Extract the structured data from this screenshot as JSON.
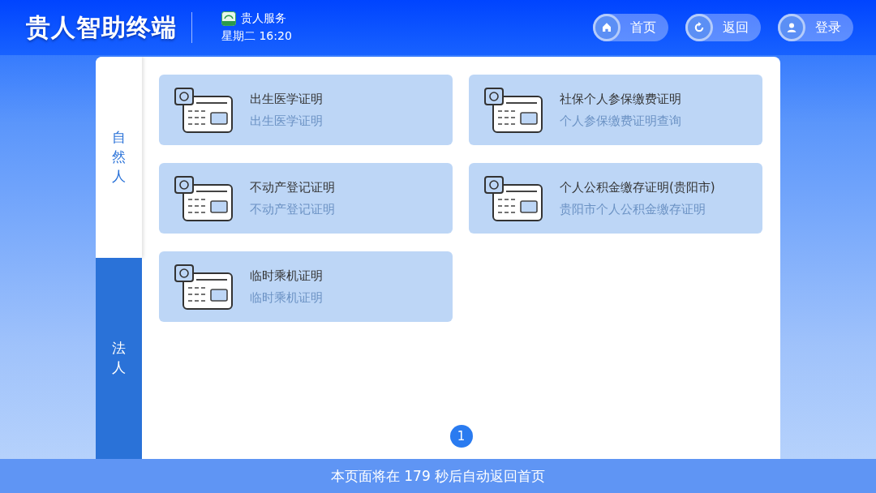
{
  "header": {
    "title": "贵人智助终端",
    "service": "贵人服务",
    "datetime": "星期二 16:20"
  },
  "nav_buttons": [
    {
      "kind": "home",
      "label": "首页"
    },
    {
      "kind": "back",
      "label": "返回"
    },
    {
      "kind": "login",
      "label": "登录"
    }
  ],
  "tabs": [
    {
      "label": "自然人",
      "selected": true
    },
    {
      "label": "法人",
      "selected": false
    }
  ],
  "cards": [
    {
      "title": "出生医学证明",
      "subtitle": "出生医学证明"
    },
    {
      "title": "社保个人参保缴费证明",
      "subtitle": "个人参保缴费证明查询"
    },
    {
      "title": "不动产登记证明",
      "subtitle": "不动产登记证明"
    },
    {
      "title": "个人公积金缴存证明(贵阳市)",
      "subtitle": "贵阳市个人公积金缴存证明"
    },
    {
      "title": "临时乘机证明",
      "subtitle": "临时乘机证明"
    }
  ],
  "pagination": [
    {
      "label": "1",
      "selected": true
    }
  ],
  "footer": "本页面将在 179 秒后自动返回首页"
}
